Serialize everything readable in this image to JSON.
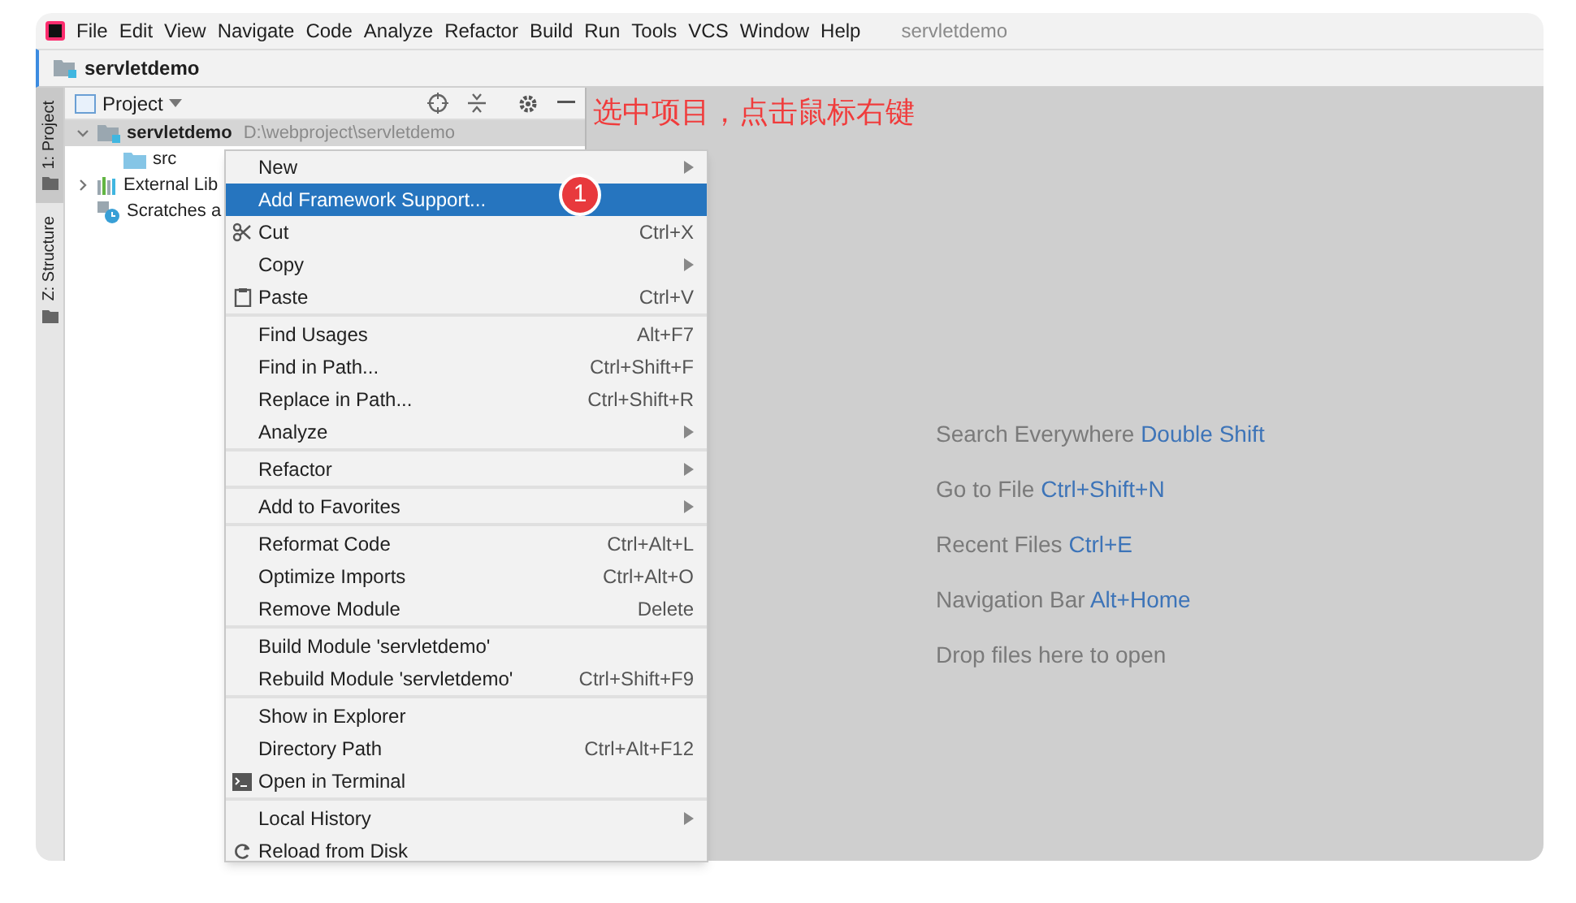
{
  "menu_bar": {
    "items": [
      "File",
      "Edit",
      "View",
      "Navigate",
      "Code",
      "Analyze",
      "Refactor",
      "Build",
      "Run",
      "Tools",
      "VCS",
      "Window",
      "Help"
    ],
    "project_title": "servletdemo"
  },
  "nav_bar": {
    "crumb": "servletdemo"
  },
  "tool_stripe": [
    {
      "label": "1: Project",
      "selected": true
    },
    {
      "label": "Z: Structure",
      "selected": false
    }
  ],
  "project_panel": {
    "title": "Project",
    "tree": [
      {
        "label": "servletdemo",
        "path": "D:\\webproject\\servletdemo",
        "kind": "module",
        "expanded": true,
        "selected": true,
        "children": [
          {
            "label": "src",
            "kind": "folder",
            "selected": false
          }
        ]
      },
      {
        "label": "External Lib",
        "kind": "library",
        "expanded": false,
        "selected": false
      },
      {
        "label": "Scratches a",
        "kind": "scratches",
        "selected": false
      }
    ]
  },
  "annotation": "选中项目，点击鼠标右键",
  "badge": "1",
  "context_menu": {
    "groups": [
      [
        {
          "label": "New",
          "submenu": true,
          "kind": "plain",
          "selected": false
        },
        {
          "label": "Add Framework Support...",
          "kind": "plain",
          "selected": true
        },
        {
          "label": "Cut",
          "shortcut": "Ctrl+X",
          "kind": "cut",
          "selected": false
        },
        {
          "label": "Copy",
          "submenu": true,
          "kind": "plain",
          "selected": false
        },
        {
          "label": "Paste",
          "shortcut": "Ctrl+V",
          "kind": "paste",
          "selected": false
        }
      ],
      [
        {
          "label": "Find Usages",
          "shortcut": "Alt+F7",
          "kind": "plain",
          "selected": false
        },
        {
          "label": "Find in Path...",
          "shortcut": "Ctrl+Shift+F",
          "kind": "plain",
          "selected": false
        },
        {
          "label": "Replace in Path...",
          "shortcut": "Ctrl+Shift+R",
          "kind": "plain",
          "selected": false
        },
        {
          "label": "Analyze",
          "submenu": true,
          "kind": "plain",
          "selected": false
        }
      ],
      [
        {
          "label": "Refactor",
          "submenu": true,
          "kind": "plain",
          "selected": false
        }
      ],
      [
        {
          "label": "Add to Favorites",
          "submenu": true,
          "kind": "plain",
          "selected": false
        }
      ],
      [
        {
          "label": "Reformat Code",
          "shortcut": "Ctrl+Alt+L",
          "kind": "plain",
          "selected": false
        },
        {
          "label": "Optimize Imports",
          "shortcut": "Ctrl+Alt+O",
          "kind": "plain",
          "selected": false
        },
        {
          "label": "Remove Module",
          "shortcut": "Delete",
          "kind": "plain",
          "selected": false
        }
      ],
      [
        {
          "label": "Build Module 'servletdemo'",
          "kind": "plain",
          "selected": false
        },
        {
          "label": "Rebuild Module 'servletdemo'",
          "shortcut": "Ctrl+Shift+F9",
          "kind": "plain",
          "selected": false
        }
      ],
      [
        {
          "label": "Show in Explorer",
          "kind": "plain",
          "selected": false
        },
        {
          "label": "Directory Path",
          "shortcut": "Ctrl+Alt+F12",
          "kind": "plain",
          "selected": false
        },
        {
          "label": "Open in Terminal",
          "kind": "terminal",
          "selected": false
        }
      ],
      [
        {
          "label": "Local History",
          "submenu": true,
          "kind": "plain",
          "selected": false
        },
        {
          "label": "Reload from Disk",
          "kind": "reload",
          "selected": false
        }
      ]
    ]
  },
  "editor_hints": [
    {
      "text": "Search Everywhere",
      "shortcut": "Double Shift"
    },
    {
      "text": "Go to File",
      "shortcut": "Ctrl+Shift+N"
    },
    {
      "text": "Recent Files",
      "shortcut": "Ctrl+E"
    },
    {
      "text": "Navigation Bar",
      "shortcut": "Alt+Home"
    },
    {
      "text": "Drop files here to open"
    }
  ]
}
